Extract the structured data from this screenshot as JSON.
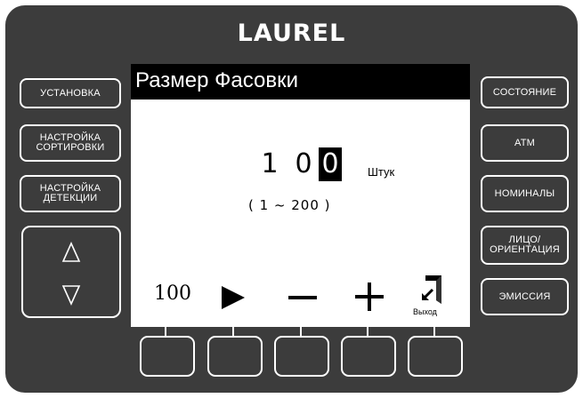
{
  "brand": "LAUREL",
  "left_buttons": [
    {
      "label": "УСТАНОВКА"
    },
    {
      "label": "НАСТРОЙКА\nСОРТИРОВКИ"
    },
    {
      "label": "НАСТРОЙКА\nДЕТЕКЦИИ"
    }
  ],
  "nav": {
    "up_icon": "up-triangle-icon",
    "down_icon": "down-triangle-icon"
  },
  "right_buttons": [
    {
      "label": "СОСТОЯНИЕ"
    },
    {
      "label": "АТМ"
    },
    {
      "label": "НОМИНАЛЫ"
    },
    {
      "label": "ЛИЦО/\nОРИЕНТАЦИЯ"
    },
    {
      "label": "ЭМИССИЯ"
    }
  ],
  "screen": {
    "title": "Размер Фасовки",
    "quantity_digits": [
      "1",
      "0",
      "0"
    ],
    "cursor_index": 2,
    "unit": "Штук",
    "range": "( 1 ~ 200 )",
    "function_bar": {
      "f1_label": "100",
      "f2_icon": "play-icon",
      "f3_icon": "minus-icon",
      "f4_icon": "plus-icon",
      "f5_icon": "exit-door-icon",
      "f5_label": "Выход"
    }
  },
  "colors": {
    "panel": "#3c3c3c",
    "screen_bg": "#ffffff",
    "title_bg": "#000000",
    "text": "#000000",
    "button_border": "#ffffff"
  }
}
